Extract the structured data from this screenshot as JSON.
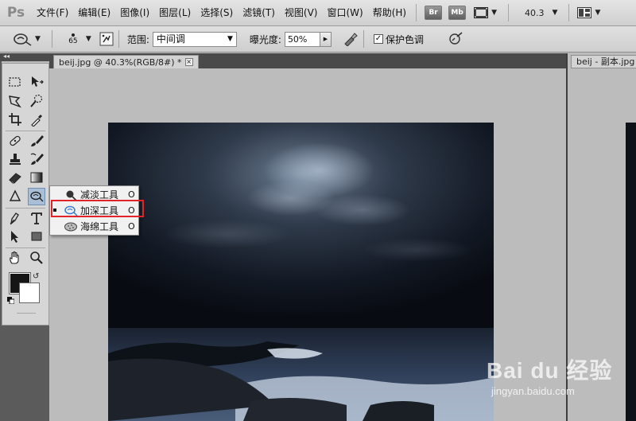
{
  "app": {
    "logo": "Ps"
  },
  "menu": {
    "items": [
      "文件(F)",
      "编辑(E)",
      "图像(I)",
      "图层(L)",
      "选择(S)",
      "滤镜(T)",
      "视图(V)",
      "窗口(W)",
      "帮助(H)"
    ],
    "bridge_label": "Br",
    "minibridge_label": "Mb",
    "zoom": "40.3"
  },
  "options": {
    "brush_size": "65",
    "range_label": "范围:",
    "range_value": "中间调",
    "exposure_label": "曝光度:",
    "exposure_value": "50%",
    "protect_label": "保护色调",
    "protect_checked": "✓"
  },
  "document": {
    "tab_title": "beij.jpg @ 40.3%(RGB/8#) *",
    "tab_close": "×",
    "second_tab_title": "beij - 副本.jpg"
  },
  "flyout": {
    "items": [
      {
        "label": "减淡工具",
        "key": "O",
        "icon": "dodge-icon"
      },
      {
        "label": "加深工具",
        "key": "O",
        "icon": "burn-icon",
        "selected": true
      },
      {
        "label": "海绵工具",
        "key": "O",
        "icon": "sponge-icon"
      }
    ]
  },
  "colors": {
    "foreground": "#151515",
    "background": "#ffffff",
    "highlight": "#e0242a",
    "active_tool": "#a9bfd8"
  },
  "watermark": {
    "brand": "Bai du 经验",
    "url": "jingyan.baidu.com"
  }
}
